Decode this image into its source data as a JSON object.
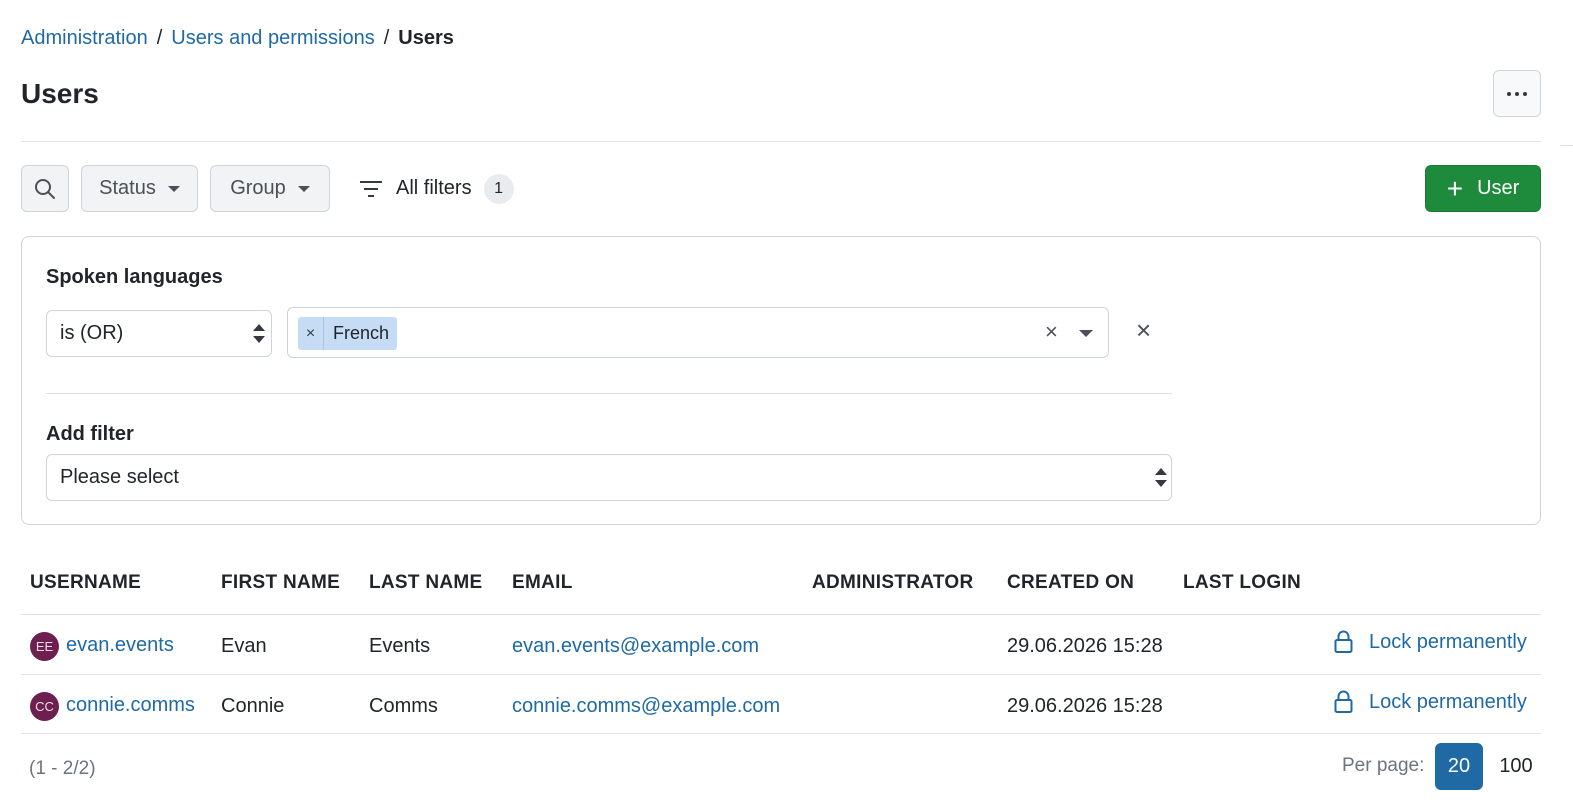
{
  "breadcrumb": {
    "items": [
      "Administration",
      "Users and permissions"
    ],
    "current": "Users",
    "separator": "/"
  },
  "page": {
    "title": "Users"
  },
  "toolbar": {
    "status_label": "Status",
    "group_label": "Group",
    "all_filters_label": "All filters",
    "all_filters_count": "1",
    "add_user_label": "User"
  },
  "filters": {
    "spoken_languages": {
      "label": "Spoken languages",
      "operator": "is (OR)",
      "chips": [
        "French"
      ],
      "chip_remove": "×",
      "clear": "×",
      "remove": "×"
    },
    "add_filter": {
      "label": "Add filter",
      "placeholder": "Please select"
    }
  },
  "table": {
    "columns": [
      "USERNAME",
      "FIRST NAME",
      "LAST NAME",
      "EMAIL",
      "ADMINISTRATOR",
      "CREATED ON",
      "LAST LOGIN"
    ],
    "rows": [
      {
        "initials": "EE",
        "username": "evan.events",
        "first_name": "Evan",
        "last_name": "Events",
        "email": "evan.events@example.com",
        "administrator": "",
        "created_on": "29.06.2026 15:28",
        "last_login": "",
        "action": "Lock permanently"
      },
      {
        "initials": "CC",
        "username": "connie.comms",
        "first_name": "Connie",
        "last_name": "Comms",
        "email": "connie.comms@example.com",
        "administrator": "",
        "created_on": "29.06.2026 15:28",
        "last_login": "",
        "action": "Lock permanently"
      }
    ]
  },
  "pagination": {
    "range": "(1 - 2/2)",
    "per_page_label": "Per page:",
    "options": [
      "20",
      "100"
    ],
    "selected": "20"
  },
  "colors": {
    "link": "#1f6aa5",
    "primary_green": "#1e8a3c",
    "avatar_bg": "#6d1f4f",
    "chip_bg": "#c6dcf5",
    "active_page": "#1f6aa5"
  },
  "icons": [
    "search-icon",
    "filter-icon",
    "plus-icon",
    "lock-icon",
    "close-icon",
    "more-icon",
    "chevron-down-icon"
  ]
}
